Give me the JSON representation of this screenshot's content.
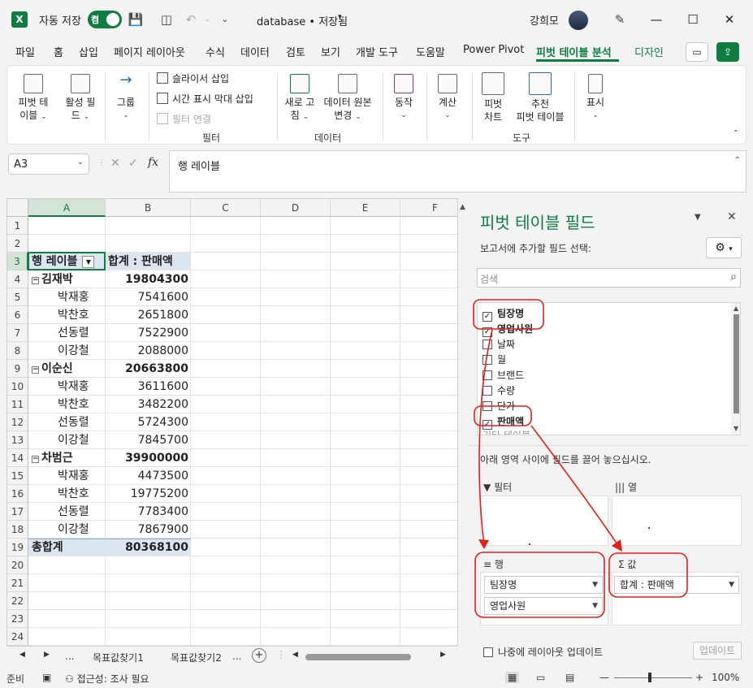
{
  "titlebar": {
    "autosave_label": "자동 저장",
    "toggle_state": "켬",
    "filename": "database • 저장됨",
    "user": "강희모"
  },
  "menu": {
    "tabs": [
      "파일",
      "홈",
      "삽입",
      "페이지 레이아웃",
      "수식",
      "데이터",
      "검토",
      "보기",
      "개발 도구",
      "도움말",
      "Power Pivot",
      "피벗 테이블 분석",
      "디자인"
    ],
    "active_tab": "피벗 테이블 분석"
  },
  "ribbon": {
    "pivot_table": [
      "피벗 테",
      "이블"
    ],
    "active_field": [
      "활성 필",
      "드"
    ],
    "group": "그룹",
    "insert_slicer": "슬라이서 삽입",
    "insert_timeline": "시간 표시 막대 삽입",
    "filter_connections": "필터 연결",
    "filter_group_label": "필터",
    "refresh": [
      "새로 고",
      "침"
    ],
    "change_source": [
      "데이터 원본",
      "변경"
    ],
    "data_group_label": "데이터",
    "actions": "동작",
    "calculations": "계산",
    "pivot_chart": [
      "피벗",
      "차트"
    ],
    "recommended": [
      "추천",
      "피벗 테이블"
    ],
    "tools_group_label": "도구",
    "show": "표시"
  },
  "formula_bar": {
    "name_box": "A3",
    "content": "행 레이블"
  },
  "grid": {
    "columns": [
      "A",
      "B",
      "C",
      "D",
      "E",
      "F"
    ],
    "rows": [
      {
        "n": "1",
        "a": "",
        "b": "",
        "t": ""
      },
      {
        "n": "2",
        "a": "",
        "b": "",
        "t": ""
      },
      {
        "n": "3",
        "a": "행 레이블",
        "b": "합계 : 판매액",
        "t": "header"
      },
      {
        "n": "4",
        "a": "김재박",
        "b": "19804300",
        "t": "group"
      },
      {
        "n": "5",
        "a": "박재홍",
        "b": "7541600",
        "t": "item"
      },
      {
        "n": "6",
        "a": "박찬호",
        "b": "2651800",
        "t": "item"
      },
      {
        "n": "7",
        "a": "선동렬",
        "b": "7522900",
        "t": "item"
      },
      {
        "n": "8",
        "a": "이강철",
        "b": "2088000",
        "t": "item"
      },
      {
        "n": "9",
        "a": "이순신",
        "b": "20663800",
        "t": "group"
      },
      {
        "n": "10",
        "a": "박재홍",
        "b": "3611600",
        "t": "item"
      },
      {
        "n": "11",
        "a": "박찬호",
        "b": "3482200",
        "t": "item"
      },
      {
        "n": "12",
        "a": "선동렬",
        "b": "5724300",
        "t": "item"
      },
      {
        "n": "13",
        "a": "이강철",
        "b": "7845700",
        "t": "item"
      },
      {
        "n": "14",
        "a": "차범근",
        "b": "39900000",
        "t": "group"
      },
      {
        "n": "15",
        "a": "박재홍",
        "b": "4473500",
        "t": "item"
      },
      {
        "n": "16",
        "a": "박찬호",
        "b": "19775200",
        "t": "item"
      },
      {
        "n": "17",
        "a": "선동렬",
        "b": "7783400",
        "t": "item"
      },
      {
        "n": "18",
        "a": "이강철",
        "b": "7867900",
        "t": "item"
      },
      {
        "n": "19",
        "a": "총합계",
        "b": "80368100",
        "t": "total"
      },
      {
        "n": "20",
        "a": "",
        "b": "",
        "t": ""
      },
      {
        "n": "21",
        "a": "",
        "b": "",
        "t": ""
      },
      {
        "n": "22",
        "a": "",
        "b": "",
        "t": ""
      },
      {
        "n": "23",
        "a": "",
        "b": "",
        "t": ""
      },
      {
        "n": "24",
        "a": "",
        "b": "",
        "t": ""
      }
    ]
  },
  "sheets": {
    "ellipsis": "...",
    "tab1": "목표값찾기1",
    "tab2": "목표값찾기2"
  },
  "pane": {
    "title": "피벗 테이블 필드",
    "subtitle": "보고서에 추가할 필드 선택:",
    "search_placeholder": "검색",
    "fields": [
      {
        "label": "팀장명",
        "checked": true
      },
      {
        "label": "영업사원",
        "checked": true
      },
      {
        "label": "날짜",
        "checked": false
      },
      {
        "label": "월",
        "checked": false
      },
      {
        "label": "브랜드",
        "checked": false
      },
      {
        "label": "수량",
        "checked": false
      },
      {
        "label": "단가",
        "checked": false
      },
      {
        "label": "판매액",
        "checked": true
      },
      {
        "label": "기타 테이블...",
        "checked": false
      }
    ],
    "drag_hint": "아래 영역 사이에 필드를 끌어 놓으십시오.",
    "areas": {
      "filter": "필터",
      "columns": "열",
      "rows": "행",
      "values": "값",
      "row_chips": [
        "팀장명",
        "영업사원"
      ],
      "value_chips": [
        "합계 : 판매액"
      ]
    },
    "defer_label": "나중에 레이아웃 업데이트",
    "update_button": "업데이트"
  },
  "status": {
    "ready": "준비",
    "accessibility": "접근성: 조사 필요",
    "zoom": "100%"
  },
  "colors": {
    "accent": "#107c41",
    "annotation": "#e0201b",
    "pivot_header": "#dce6f1"
  }
}
